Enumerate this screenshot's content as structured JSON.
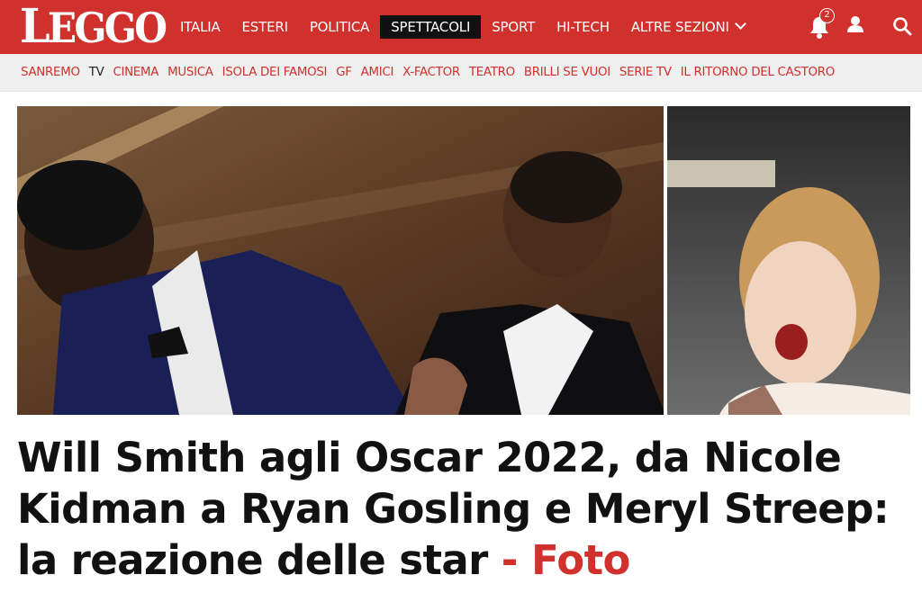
{
  "site": {
    "logo_text": "LEGGO",
    "logo_first": "L",
    "logo_rest": "EGGO",
    "brand_color": "#d0312d"
  },
  "main_nav": {
    "items": [
      {
        "label": "ITALIA",
        "active": false
      },
      {
        "label": "ESTERI",
        "active": false
      },
      {
        "label": "POLITICA",
        "active": false
      },
      {
        "label": "SPETTACOLI",
        "active": true
      },
      {
        "label": "SPORT",
        "active": false
      },
      {
        "label": "HI-TECH",
        "active": false
      },
      {
        "label": "ALTRE SEZIONI",
        "active": false
      }
    ]
  },
  "header_icons": {
    "notifications_count": "2",
    "bell_icon": "bell-icon",
    "user_icon": "user-icon",
    "search_icon": "search-icon",
    "more_icon": "chevron-down-icon"
  },
  "sub_nav": {
    "items": [
      {
        "label": "SANREMO",
        "current": false
      },
      {
        "label": "TV",
        "current": true
      },
      {
        "label": "CINEMA",
        "current": false
      },
      {
        "label": "MUSICA",
        "current": false
      },
      {
        "label": "ISOLA DEI FAMOSI",
        "current": false
      },
      {
        "label": "GF",
        "current": false
      },
      {
        "label": "AMICI",
        "current": false
      },
      {
        "label": "X-FACTOR",
        "current": false
      },
      {
        "label": "TEATRO",
        "current": false
      },
      {
        "label": "BRILLI SE VUOI",
        "current": false
      },
      {
        "label": "SERIE TV",
        "current": false
      },
      {
        "label": "IL RITORNO DEL CASTORO",
        "current": false
      }
    ]
  },
  "article": {
    "headline": "Will Smith agli Oscar 2022, da Nicole Kidman a Ryan Gosling e Meryl Streep: la reazione delle star",
    "headline_suffix": "- Foto"
  }
}
